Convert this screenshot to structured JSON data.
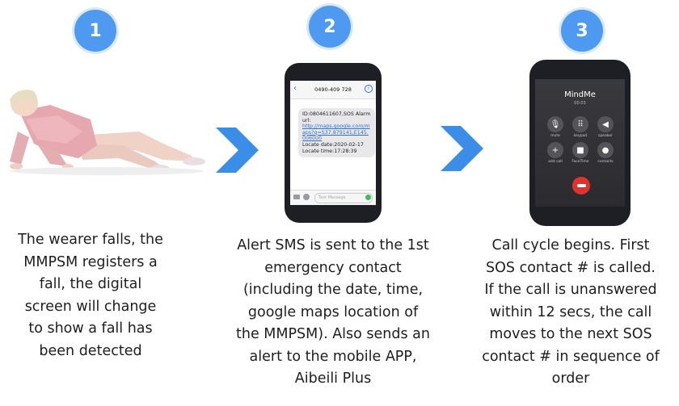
{
  "steps": [
    {
      "number": "1",
      "caption": [
        "The wearer falls, the",
        "MMPSM registers a",
        "fall, the digital",
        "screen will change",
        "to show a fall has",
        "been detected"
      ]
    },
    {
      "number": "2",
      "caption": [
        "Alert SMS is sent to the 1st",
        "emergency contact",
        "(including the date, time,",
        "google maps location of",
        "the MMPSM). Also sends an",
        "alert to the mobile APP,",
        "Aibeili Plus"
      ]
    },
    {
      "number": "3",
      "caption": [
        "Call cycle begins. First",
        "SOS contact # is called.",
        "If the call is unanswered",
        "within 12 secs, the call",
        "moves to the next SOS",
        "contact # in sequence of",
        "order"
      ]
    }
  ],
  "sms_phone": {
    "contact": "0490-409 728",
    "message_lines": [
      "ID:0804611607,SOS Alarm",
      "url:"
    ],
    "link": "http://maps.google.com/maps?q=S37.879141,E145.006000",
    "footer_lines": [
      "Locate date:2020-02-17",
      "Locate time:17:28:39"
    ],
    "input_placeholder": "Text Message"
  },
  "call_phone": {
    "caller_name": "MindMe",
    "status": "00:03",
    "buttons": [
      "mute",
      "keypad",
      "speaker",
      "add call",
      "FaceTime",
      "contacts"
    ]
  },
  "colors": {
    "badge": "#4d9af0",
    "arrow": "#3b8ee8",
    "end_call": "#e0332e"
  }
}
